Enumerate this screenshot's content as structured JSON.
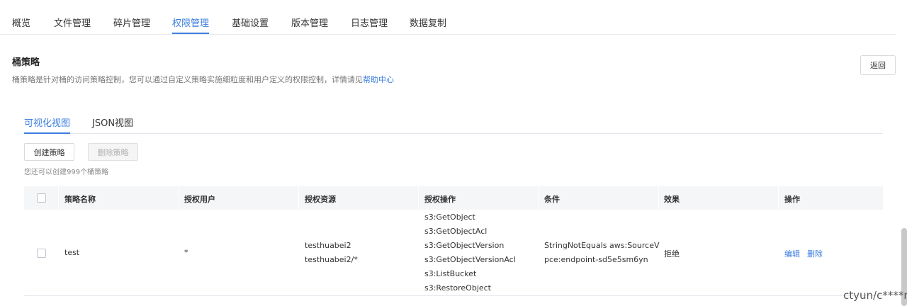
{
  "top_tabs": [
    {
      "label": "概览"
    },
    {
      "label": "文件管理"
    },
    {
      "label": "碎片管理"
    },
    {
      "label": "权限管理",
      "active": true
    },
    {
      "label": "基础设置"
    },
    {
      "label": "版本管理"
    },
    {
      "label": "日志管理"
    },
    {
      "label": "数据复制"
    }
  ],
  "section": {
    "title": "桶策略",
    "description": "桶策略是针对桶的访问策略控制，您可以通过自定义策略实施细粒度和用户定义的权限控制，详情请见",
    "help_link": "帮助中心",
    "back_label": "返回"
  },
  "view_tabs": [
    {
      "label": "可视化视图",
      "active": true
    },
    {
      "label": "JSON视图"
    }
  ],
  "actions": {
    "create_label": "创建策略",
    "delete_label": "删除策略",
    "hint": "您还可以创建999个桶策略"
  },
  "table": {
    "columns": [
      "策略名称",
      "授权用户",
      "授权资源",
      "授权操作",
      "条件",
      "效果",
      "操作"
    ],
    "rows": [
      {
        "name": "test",
        "user": "*",
        "resources": [
          "testhuabei2",
          "testhuabei2/*"
        ],
        "operations": [
          "s3:GetObject",
          "s3:GetObjectAcl",
          "s3:GetObjectVersion",
          "s3:GetObjectVersionAcl",
          "s3:ListBucket",
          "s3:RestoreObject"
        ],
        "condition": [
          "StringNotEquals aws:SourceV",
          "pce:endpoint-sd5e5sm6yn"
        ],
        "effect": "拒绝",
        "edit_label": "编辑",
        "delete_label": "删除"
      }
    ]
  },
  "watermark": "ctyun/c****n"
}
